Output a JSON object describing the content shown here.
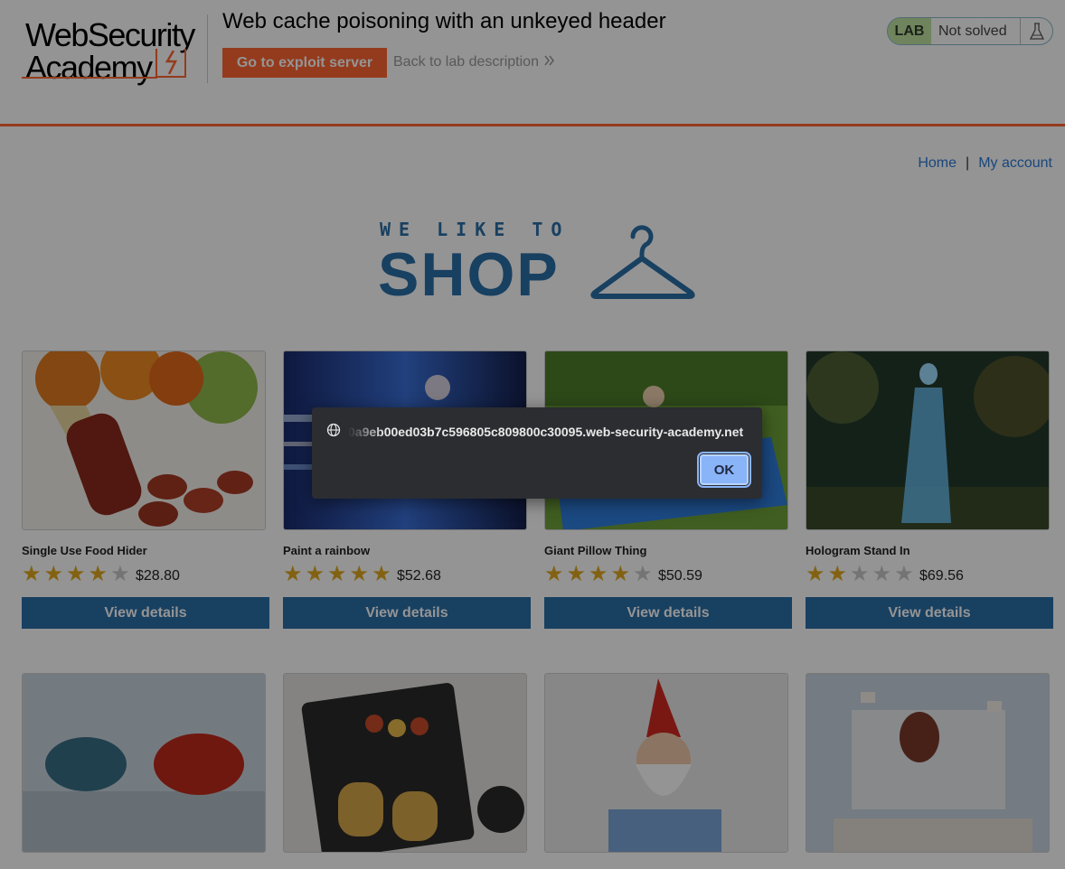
{
  "header": {
    "logo_line1": "WebSecurity",
    "logo_line2": "Academy",
    "lab_title": "Web cache poisoning with an unkeyed header",
    "exploit_button": "Go to exploit server",
    "back_link": "Back to lab description",
    "lab_badge": "LAB",
    "status": "Not solved"
  },
  "nav": {
    "home": "Home",
    "separator": "|",
    "my_account": "My account"
  },
  "banner": {
    "tagline": "WE LIKE TO",
    "shop": "SHOP"
  },
  "products": [
    {
      "name": "Single Use Food Hider",
      "rating": 4,
      "price": "$28.80",
      "button": "View details"
    },
    {
      "name": "Paint a rainbow",
      "rating": 5,
      "price": "$52.68",
      "button": "View details"
    },
    {
      "name": "Giant Pillow Thing",
      "rating": 4,
      "price": "$50.59",
      "button": "View details"
    },
    {
      "name": "Hologram Stand In",
      "rating": 2,
      "price": "$69.56",
      "button": "View details"
    }
  ],
  "dialog": {
    "origin": "0a9eb00ed03b7c596805c809800c30095.web-security-academy.net",
    "ok_label": "OK"
  },
  "colors": {
    "accent": "#ff6633",
    "primary": "#2a6fa8",
    "star": "#e0a91f",
    "dialog_bg": "#2b2d31",
    "ok_button": "#8ab4f8"
  }
}
